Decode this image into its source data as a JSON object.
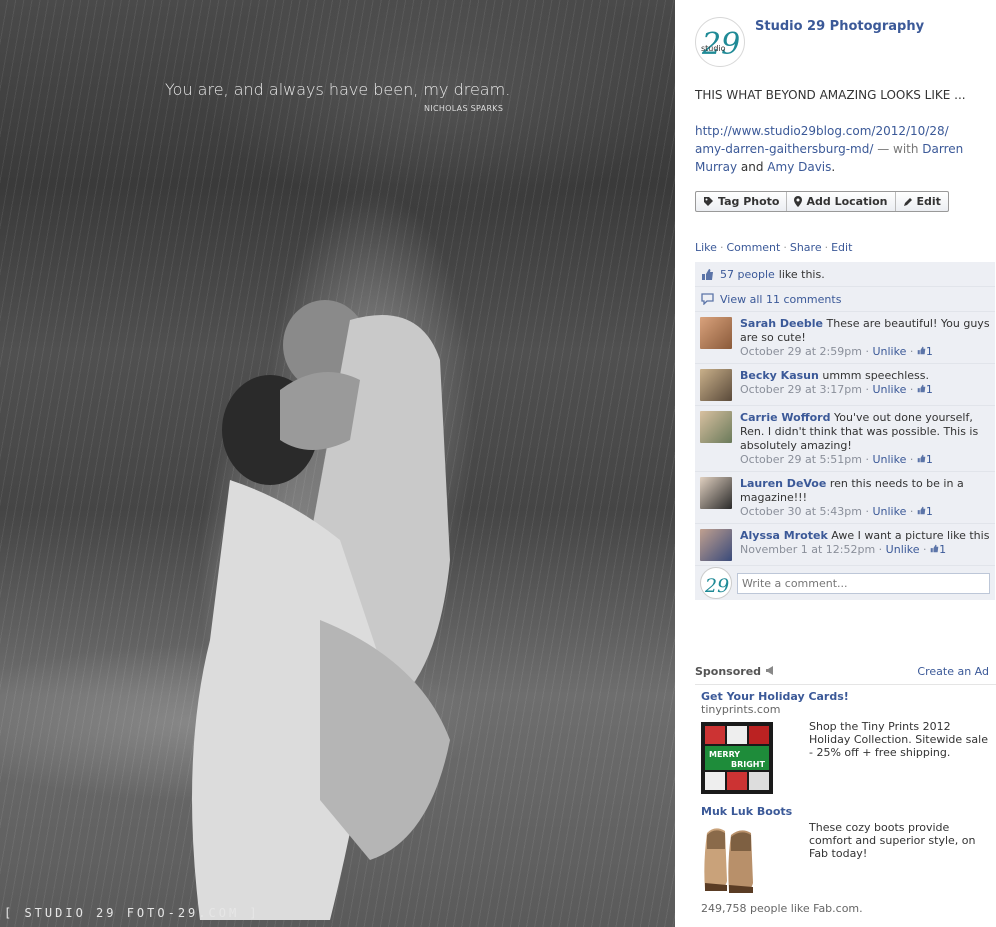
{
  "photo": {
    "quote": "You are, and always have been, my dream.",
    "quote_author": "NICHOLAS SPARKS",
    "watermark": "[ STUDIO 29 FOTO-29.COM ]"
  },
  "post": {
    "page_name": "Studio 29 Photography",
    "logo_text": "studio",
    "logo_number": "29",
    "caption": "THIS WHAT BEYOND AMAZING LOOKS LIKE ...",
    "link_line1": "http://www.studio29blog.com/2012/10/28/",
    "link_line2": "amy-darren-gaithersburg-md/",
    "with_text": " — with ",
    "tagged_1_line1": "Darren",
    "tagged_1_line2": "Murray",
    "and_text": " and ",
    "tagged_2": "Amy Davis",
    "period": "."
  },
  "photo_actions": {
    "tag_photo": "Tag Photo",
    "add_location": "Add Location",
    "edit": "Edit"
  },
  "ufi": {
    "like": "Like",
    "comment": "Comment",
    "share": "Share",
    "edit": "Edit",
    "sep": "·",
    "likes_link": "57 people",
    "likes_text": "like this.",
    "view_comments": "View all 11 comments",
    "write_placeholder": "Write a comment..."
  },
  "comments": [
    {
      "name": "Sarah Deeble",
      "text": "These are beautiful! You guys are so cute!",
      "time": "October 29 at 2:59pm",
      "unlike": "Unlike",
      "likes": "1"
    },
    {
      "name": "Becky Kasun",
      "text": "ummm speechless.",
      "time": "October 29 at 3:17pm",
      "unlike": "Unlike",
      "likes": "1"
    },
    {
      "name": "Carrie Wofford",
      "text": "You've out done yourself, Ren. I didn't think that was possible. This is absolutely amazing!",
      "time": "October 29 at 5:51pm",
      "unlike": "Unlike",
      "likes": "1"
    },
    {
      "name": "Lauren DeVoe",
      "text": "ren this needs to be in a magazine!!!",
      "time": "October 30 at 5:43pm",
      "unlike": "Unlike",
      "likes": "1"
    },
    {
      "name": "Alyssa Mrotek",
      "text": "Awe I want a picture like this",
      "time": "November 1 at 12:52pm",
      "unlike": "Unlike",
      "likes": "1"
    }
  ],
  "sponsored": {
    "label": "Sponsored",
    "create_ad": "Create an Ad",
    "ads": [
      {
        "title": "Get Your Holiday Cards!",
        "domain": "tinyprints.com",
        "text": "Shop the Tiny Prints 2012 Holiday Collection. Sitewide sale - 25% off + free shipping.",
        "img_text_1": "MERRY",
        "img_text_2": "BRIGHT"
      },
      {
        "title": "Muk Luk Boots",
        "domain": "",
        "text": "These cozy boots provide comfort and superior style, on Fab today!",
        "social": "249,758 people like Fab.com."
      }
    ]
  },
  "colors": {
    "link": "#3b5998",
    "ufi_bg": "#edeff4",
    "logo_teal": "#1f8a96"
  }
}
